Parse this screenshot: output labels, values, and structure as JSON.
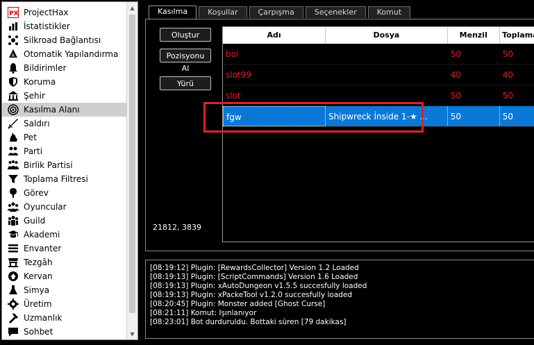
{
  "sidebar": {
    "items": [
      {
        "label": "ProjectHax",
        "icon": "projecthax-logo-icon",
        "name": "sidebar-item-projecthax"
      },
      {
        "label": "İstatistikler",
        "icon": "statistics-icon",
        "name": "sidebar-item-istatistikler"
      },
      {
        "label": "Silkroad Bağlantısı",
        "icon": "connection-icon",
        "name": "sidebar-item-silkroad-baglantisi"
      },
      {
        "label": "Otomatik Yapılandırma",
        "icon": "auto-config-icon",
        "name": "sidebar-item-otomatik-yapilandirma"
      },
      {
        "label": "Bildirimler",
        "icon": "bell-icon",
        "name": "sidebar-item-bildirimler"
      },
      {
        "label": "Koruma",
        "icon": "shield-icon",
        "name": "sidebar-item-koruma"
      },
      {
        "label": "Şehir",
        "icon": "town-icon",
        "name": "sidebar-item-sehir"
      },
      {
        "label": "Kasılma Alanı",
        "icon": "training-area-icon",
        "name": "sidebar-item-kasilma-alani"
      },
      {
        "label": "Saldırı",
        "icon": "sword-icon",
        "name": "sidebar-item-saldiri"
      },
      {
        "label": "Pet",
        "icon": "pet-icon",
        "name": "sidebar-item-pet"
      },
      {
        "label": "Parti",
        "icon": "party-icon",
        "name": "sidebar-item-parti"
      },
      {
        "label": "Birlik Partisi",
        "icon": "alliance-party-icon",
        "name": "sidebar-item-birlik-partisi"
      },
      {
        "label": "Toplama Filtresi",
        "icon": "filter-icon",
        "name": "sidebar-item-toplama-filtresi"
      },
      {
        "label": "Görev",
        "icon": "quest-icon",
        "name": "sidebar-item-gorev"
      },
      {
        "label": "Oyuncular",
        "icon": "players-icon",
        "name": "sidebar-item-oyuncular"
      },
      {
        "label": "Guild",
        "icon": "guild-icon",
        "name": "sidebar-item-guild"
      },
      {
        "label": "Akademi",
        "icon": "academy-icon",
        "name": "sidebar-item-akademi"
      },
      {
        "label": "Envanter",
        "icon": "inventory-icon",
        "name": "sidebar-item-envanter"
      },
      {
        "label": "Tezgâh",
        "icon": "stall-icon",
        "name": "sidebar-item-tezgah"
      },
      {
        "label": "Kervan",
        "icon": "caravan-icon",
        "name": "sidebar-item-kervan"
      },
      {
        "label": "Simya",
        "icon": "alchemy-icon",
        "name": "sidebar-item-simya"
      },
      {
        "label": "Üretim",
        "icon": "production-icon",
        "name": "sidebar-item-uretim"
      },
      {
        "label": "Uzmanlık",
        "icon": "expertise-icon",
        "name": "sidebar-item-uzmanlik"
      },
      {
        "label": "Sohbet",
        "icon": "chat-icon",
        "name": "sidebar-item-sohbet"
      }
    ],
    "active_index": 7
  },
  "tabs": [
    {
      "label": "Kasılma",
      "active": true
    },
    {
      "label": "Koşullar",
      "active": false
    },
    {
      "label": "Çarpışma",
      "active": false
    },
    {
      "label": "Seçenekler",
      "active": false
    },
    {
      "label": "Komut",
      "active": false
    }
  ],
  "buttons": {
    "create": "Oluştur",
    "position": "Pozisyonu Al",
    "walk": "Yürü"
  },
  "coords_text": "21812, 3839",
  "table": {
    "columns": [
      "Adı",
      "Dosya",
      "Menzil",
      "Toplama"
    ],
    "rows": [
      {
        "name": "boi",
        "file": "",
        "range": "50",
        "pickup": "50",
        "style": "red"
      },
      {
        "name": "slot99",
        "file": "",
        "range": "40",
        "pickup": "40",
        "style": "red"
      },
      {
        "name": "slot",
        "file": "",
        "range": "50",
        "pickup": "50",
        "style": "red"
      },
      {
        "name": "fgw",
        "file": "Shipwreck İnside 1-★ ...",
        "range": "50",
        "pickup": "50",
        "style": "selected"
      }
    ]
  },
  "log": [
    "[08:19:12] Plugin: [RewardsCollector] Version 1.2 Loaded",
    "[08:19:13] Plugin: [ScriptCommands] Version 1.6 Loaded",
    "[08:19:13] Plugin: xAutoDungeon v1.5.5 succesfully loaded",
    "[08:19:13] Plugin: xPackeTool v1.2.0 succesfully loaded",
    "[08:20:45] Plugin: Monster added [Ghost Curse]",
    "[08:21:11] Komut: Işınlanıyor",
    "[08:23:01] Bot durduruldu. Bottaki süren [79 dakikas]"
  ],
  "colors": {
    "background": "#000000",
    "selection": "#0a78d7",
    "inactive_row_text": "#e02020",
    "highlight_box": "#e0202a"
  }
}
